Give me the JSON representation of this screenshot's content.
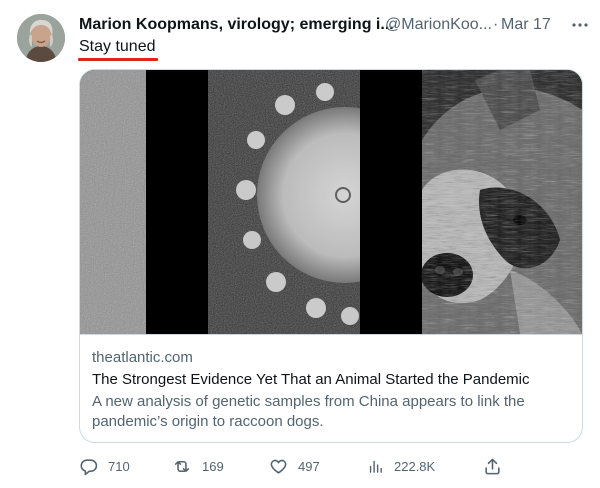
{
  "author": {
    "name": "Marion Koopmans, virology; emerging i...",
    "handle": "@MarionKoo...",
    "separator": "·",
    "date": "Mar 17"
  },
  "tweet": {
    "text": "Stay tuned"
  },
  "card": {
    "domain": "theatlantic.com",
    "title": "The Strongest Evidence Yet That an Animal Started the Pandemic",
    "description": "A new analysis of genetic samples from China appears to link the pandemic’s origin to raccoon dogs."
  },
  "actions": {
    "reply_count": "710",
    "retweet_count": "169",
    "like_count": "497",
    "views_count": "222.8K"
  },
  "icons": {
    "more": "more-dots-icon",
    "reply": "reply-bubble-icon",
    "retweet": "retweet-arrows-icon",
    "like": "heart-icon",
    "views": "views-bar-chart-icon",
    "share": "share-upload-icon"
  },
  "colors": {
    "text": "#0f1419",
    "secondary": "#536471",
    "border": "#cfd9de",
    "annotation_underline": "#e0241c"
  }
}
